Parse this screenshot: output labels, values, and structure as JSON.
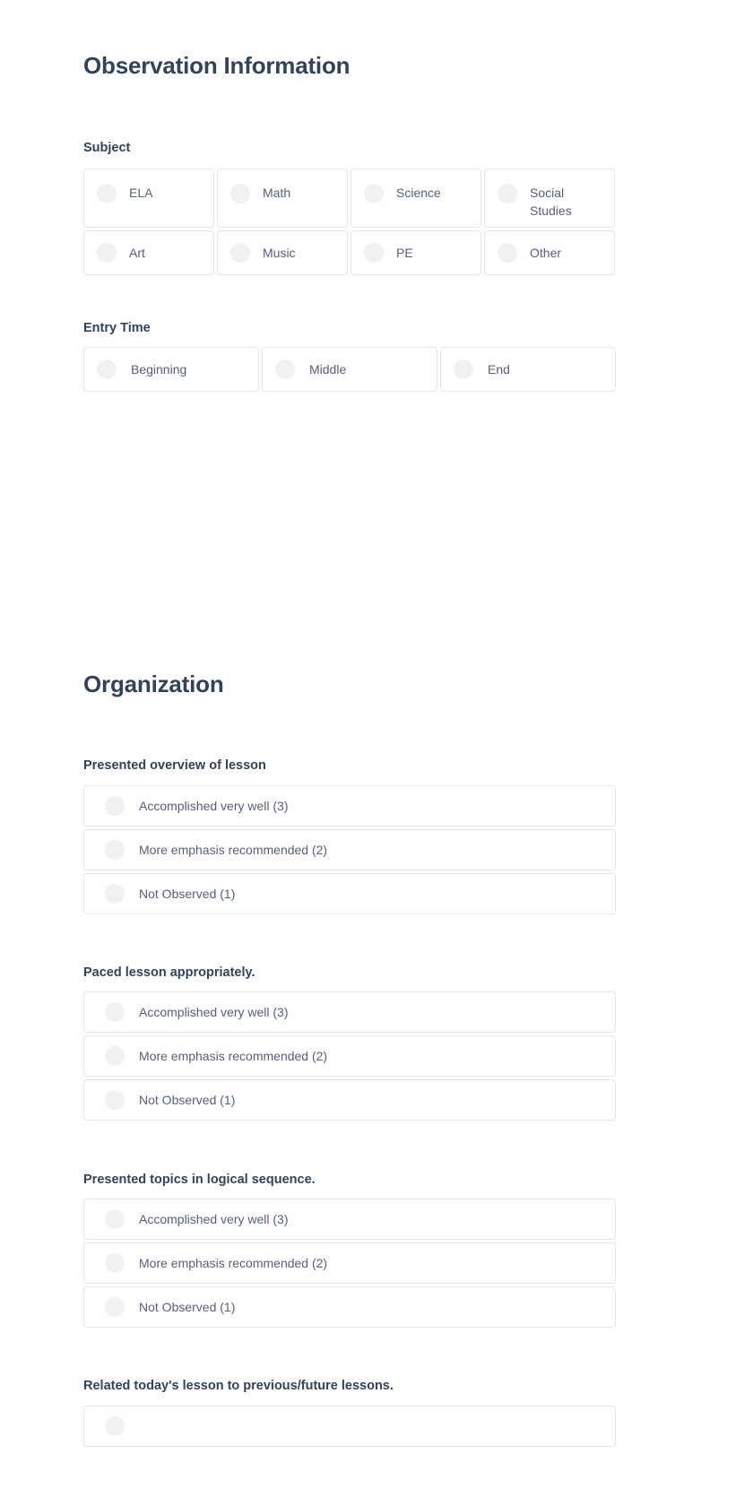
{
  "sections": [
    {
      "id": "observation-information",
      "title": "Observation Information",
      "groups": [
        {
          "id": "subject",
          "label": "Subject",
          "layout": "grid-4",
          "options": [
            {
              "label": "ELA"
            },
            {
              "label": "Math"
            },
            {
              "label": "Science"
            },
            {
              "label": "Social Studies"
            },
            {
              "label": "Art"
            },
            {
              "label": "Music"
            },
            {
              "label": "PE"
            },
            {
              "label": "Other"
            }
          ]
        },
        {
          "id": "entry-time",
          "label": "Entry Time",
          "layout": "grid-3",
          "options": [
            {
              "label": "Beginning"
            },
            {
              "label": "Middle"
            },
            {
              "label": "End"
            }
          ]
        }
      ]
    },
    {
      "id": "organization",
      "title": "Organization",
      "groups": [
        {
          "id": "presented-overview-of-lesson",
          "label": "Presented overview of lesson",
          "layout": "stack",
          "options": [
            {
              "label": "Accomplished very well (3)"
            },
            {
              "label": "More emphasis recommended (2)"
            },
            {
              "label": "Not Observed (1)"
            }
          ]
        },
        {
          "id": "paced-lesson-appropriately",
          "label": "Paced lesson appropriately.",
          "layout": "stack",
          "options": [
            {
              "label": "Accomplished very well (3)"
            },
            {
              "label": "More emphasis recommended (2)"
            },
            {
              "label": "Not Observed (1)"
            }
          ]
        },
        {
          "id": "presented-topics-in-logical-sequence",
          "label": "Presented topics in logical sequence.",
          "layout": "stack",
          "options": [
            {
              "label": "Accomplished very well (3)"
            },
            {
              "label": "More emphasis recommended (2)"
            },
            {
              "label": "Not Observed (1)"
            }
          ]
        },
        {
          "id": "related-todays-lesson",
          "label": "Related today's lesson to previous/future lessons.",
          "layout": "stack",
          "options": []
        }
      ]
    }
  ],
  "colors": {
    "heading": "#32435a",
    "option_text": "#55607a",
    "card_border": "#e3e5e8",
    "radio_fill": "#f1f1f2",
    "background": "#ffffff"
  }
}
